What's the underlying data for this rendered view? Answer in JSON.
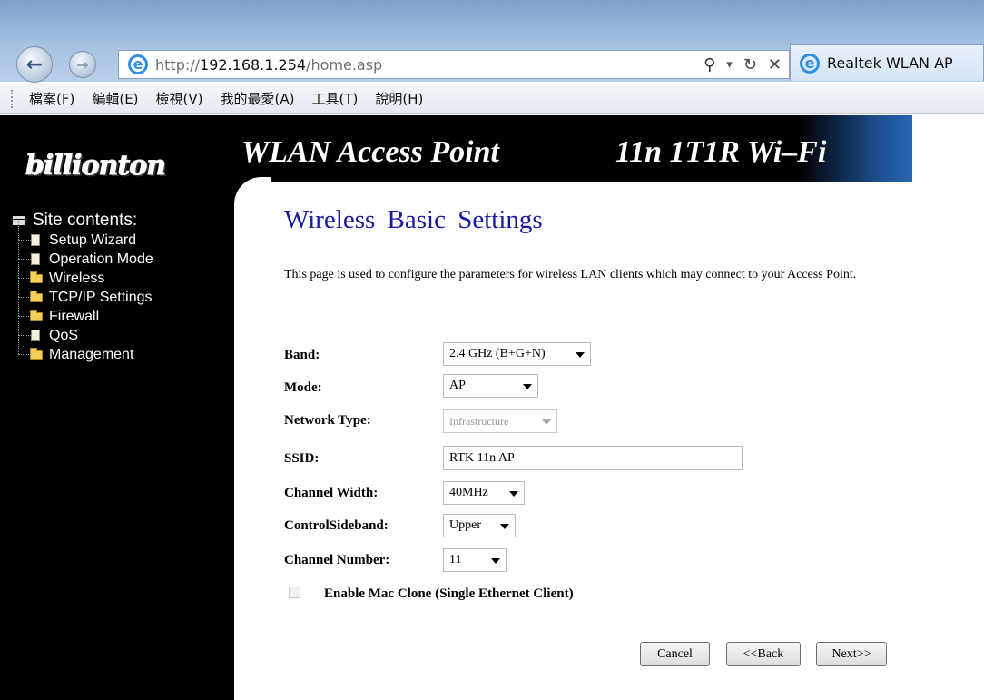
{
  "browser": {
    "url_prefix": "http://",
    "url_host": "192.168.1.254",
    "url_path": "/home.asp",
    "tab_title": "Realtek WLAN AP",
    "ie_glyph": "e",
    "search_glyph": "⚲",
    "dropdown_glyph": "▾",
    "refresh_glyph": "↻",
    "stop_glyph": "✕",
    "back_glyph": "←",
    "forward_glyph": "→"
  },
  "menu": [
    "檔案(F)",
    "編輯(E)",
    "檢視(V)",
    "我的最愛(A)",
    "工具(T)",
    "說明(H)"
  ],
  "brand": {
    "logo": "billionton",
    "banner_left": "WLAN Access Point",
    "banner_right": "11n  1T1R Wi–Fi"
  },
  "sidebar": {
    "root": "Site contents:",
    "items": [
      {
        "label": "Setup Wizard",
        "icon": "document-icon"
      },
      {
        "label": "Operation Mode",
        "icon": "document-icon"
      },
      {
        "label": "Wireless",
        "icon": "folder-icon"
      },
      {
        "label": "TCP/IP Settings",
        "icon": "folder-icon"
      },
      {
        "label": "Firewall",
        "icon": "folder-icon"
      },
      {
        "label": "QoS",
        "icon": "document-icon"
      },
      {
        "label": "Management",
        "icon": "folder-icon"
      }
    ]
  },
  "main": {
    "title": "Wireless  Basic Settings",
    "intro": "This page is used to configure the parameters for wireless LAN clients which may connect to your Access Point.",
    "fields": {
      "band": {
        "label": "Band:",
        "value": "2.4 GHz (B+G+N)"
      },
      "mode": {
        "label": "Mode:",
        "value": "AP"
      },
      "network_type": {
        "label": "Network Type:",
        "value": "Infrastructure",
        "disabled": true
      },
      "ssid": {
        "label": "SSID:",
        "value": "RTK 11n AP"
      },
      "channel_width": {
        "label": "Channel Width:",
        "value": "40MHz"
      },
      "control_sideband": {
        "label": "ControlSideband:",
        "value": "Upper"
      },
      "channel_number": {
        "label": "Channel Number:",
        "value": "11"
      }
    },
    "mac_clone": {
      "label": "Enable Mac Clone (Single Ethernet Client)",
      "checked": false,
      "disabled": true
    },
    "buttons": {
      "cancel": "Cancel",
      "back": "<<Back",
      "next": "Next>>"
    }
  }
}
